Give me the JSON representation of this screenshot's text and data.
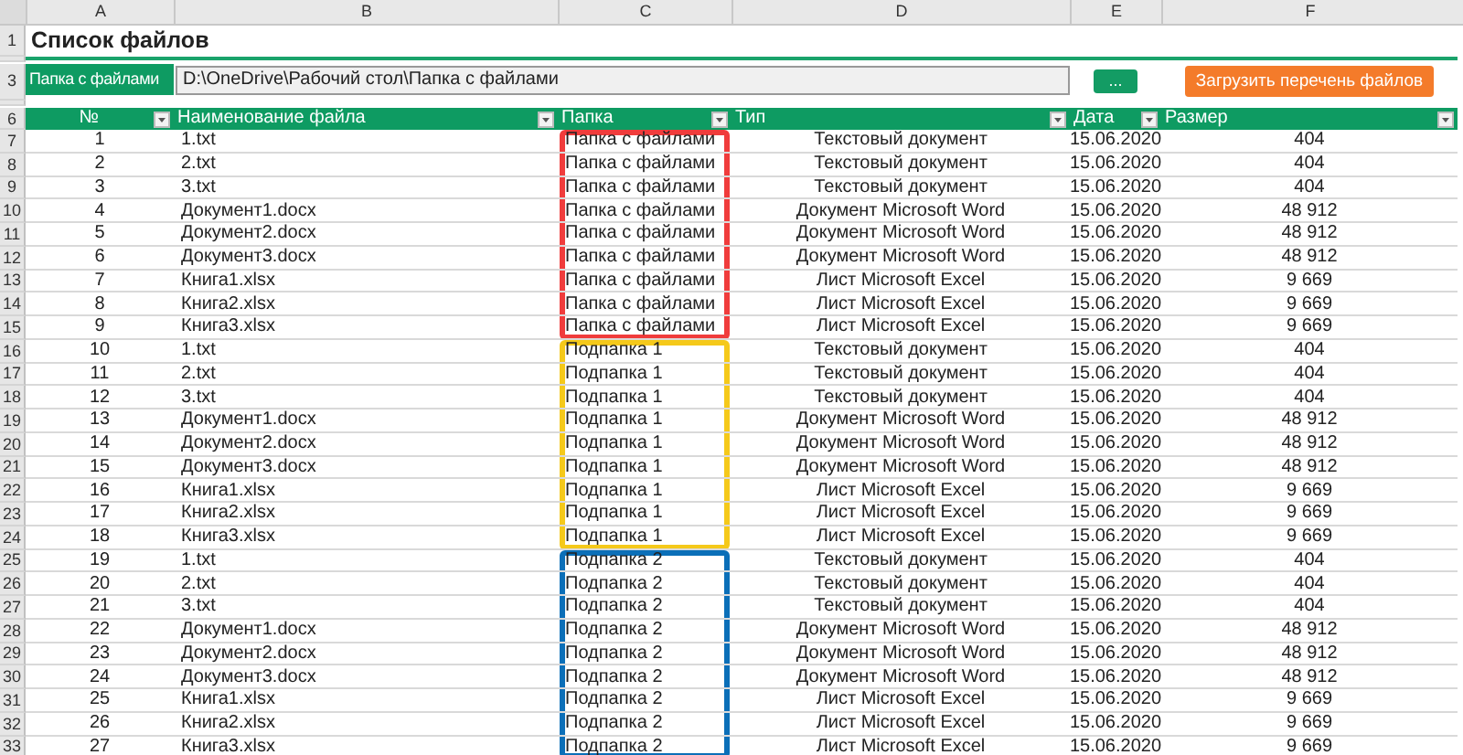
{
  "column_letters": [
    "A",
    "B",
    "C",
    "D",
    "E",
    "F"
  ],
  "title_row": {
    "row_number": "1",
    "title": "Список файлов"
  },
  "path_row": {
    "row_number": "3",
    "label": "Папка с файлами",
    "value": "D:\\OneDrive\\Рабочий стол\\Папка с файлами",
    "browse_button": "...",
    "load_button": "Загрузить перечень файлов"
  },
  "header_row": {
    "row_number": "6",
    "columns": [
      "№",
      "Наименование файла",
      "Папка",
      "Тип",
      "Дата",
      "Размер"
    ]
  },
  "groups": [
    {
      "color": "#f03c3c",
      "rows": [
        {
          "row_number": "7",
          "num": "1",
          "name": "1.txt",
          "folder": "Папка с файлами",
          "type": "Текстовый документ",
          "date": "15.06.2020",
          "size": "404"
        },
        {
          "row_number": "8",
          "num": "2",
          "name": "2.txt",
          "folder": "Папка с файлами",
          "type": "Текстовый документ",
          "date": "15.06.2020",
          "size": "404"
        },
        {
          "row_number": "9",
          "num": "3",
          "name": "3.txt",
          "folder": "Папка с файлами",
          "type": "Текстовый документ",
          "date": "15.06.2020",
          "size": "404"
        },
        {
          "row_number": "10",
          "num": "4",
          "name": "Документ1.docx",
          "folder": "Папка с файлами",
          "type": "Документ Microsoft Word",
          "date": "15.06.2020",
          "size": "48 912"
        },
        {
          "row_number": "11",
          "num": "5",
          "name": "Документ2.docx",
          "folder": "Папка с файлами",
          "type": "Документ Microsoft Word",
          "date": "15.06.2020",
          "size": "48 912"
        },
        {
          "row_number": "12",
          "num": "6",
          "name": "Документ3.docx",
          "folder": "Папка с файлами",
          "type": "Документ Microsoft Word",
          "date": "15.06.2020",
          "size": "48 912"
        },
        {
          "row_number": "13",
          "num": "7",
          "name": "Книга1.xlsx",
          "folder": "Папка с файлами",
          "type": "Лист Microsoft Excel",
          "date": "15.06.2020",
          "size": "9 669"
        },
        {
          "row_number": "14",
          "num": "8",
          "name": "Книга2.xlsx",
          "folder": "Папка с файлами",
          "type": "Лист Microsoft Excel",
          "date": "15.06.2020",
          "size": "9 669"
        },
        {
          "row_number": "15",
          "num": "9",
          "name": "Книга3.xlsx",
          "folder": "Папка с файлами",
          "type": "Лист Microsoft Excel",
          "date": "15.06.2020",
          "size": "9 669"
        }
      ]
    },
    {
      "color": "#f5c91a",
      "rows": [
        {
          "row_number": "16",
          "num": "10",
          "name": "1.txt",
          "folder": "Подпапка 1",
          "type": "Текстовый документ",
          "date": "15.06.2020",
          "size": "404"
        },
        {
          "row_number": "17",
          "num": "11",
          "name": "2.txt",
          "folder": "Подпапка 1",
          "type": "Текстовый документ",
          "date": "15.06.2020",
          "size": "404"
        },
        {
          "row_number": "18",
          "num": "12",
          "name": "3.txt",
          "folder": "Подпапка 1",
          "type": "Текстовый документ",
          "date": "15.06.2020",
          "size": "404"
        },
        {
          "row_number": "19",
          "num": "13",
          "name": "Документ1.docx",
          "folder": "Подпапка 1",
          "type": "Документ Microsoft Word",
          "date": "15.06.2020",
          "size": "48 912"
        },
        {
          "row_number": "20",
          "num": "14",
          "name": "Документ2.docx",
          "folder": "Подпапка 1",
          "type": "Документ Microsoft Word",
          "date": "15.06.2020",
          "size": "48 912"
        },
        {
          "row_number": "21",
          "num": "15",
          "name": "Документ3.docx",
          "folder": "Подпапка 1",
          "type": "Документ Microsoft Word",
          "date": "15.06.2020",
          "size": "48 912"
        },
        {
          "row_number": "22",
          "num": "16",
          "name": "Книга1.xlsx",
          "folder": "Подпапка 1",
          "type": "Лист Microsoft Excel",
          "date": "15.06.2020",
          "size": "9 669"
        },
        {
          "row_number": "23",
          "num": "17",
          "name": "Книга2.xlsx",
          "folder": "Подпапка 1",
          "type": "Лист Microsoft Excel",
          "date": "15.06.2020",
          "size": "9 669"
        },
        {
          "row_number": "24",
          "num": "18",
          "name": "Книга3.xlsx",
          "folder": "Подпапка 1",
          "type": "Лист Microsoft Excel",
          "date": "15.06.2020",
          "size": "9 669"
        }
      ]
    },
    {
      "color": "#0b6fb8",
      "rows": [
        {
          "row_number": "25",
          "num": "19",
          "name": "1.txt",
          "folder": "Подпапка 2",
          "type": "Текстовый документ",
          "date": "15.06.2020",
          "size": "404"
        },
        {
          "row_number": "26",
          "num": "20",
          "name": "2.txt",
          "folder": "Подпапка 2",
          "type": "Текстовый документ",
          "date": "15.06.2020",
          "size": "404"
        },
        {
          "row_number": "27",
          "num": "21",
          "name": "3.txt",
          "folder": "Подпапка 2",
          "type": "Текстовый документ",
          "date": "15.06.2020",
          "size": "404"
        },
        {
          "row_number": "28",
          "num": "22",
          "name": "Документ1.docx",
          "folder": "Подпапка 2",
          "type": "Документ Microsoft Word",
          "date": "15.06.2020",
          "size": "48 912"
        },
        {
          "row_number": "29",
          "num": "23",
          "name": "Документ2.docx",
          "folder": "Подпапка 2",
          "type": "Документ Microsoft Word",
          "date": "15.06.2020",
          "size": "48 912"
        },
        {
          "row_number": "30",
          "num": "24",
          "name": "Документ3.docx",
          "folder": "Подпапка 2",
          "type": "Документ Microsoft Word",
          "date": "15.06.2020",
          "size": "48 912"
        },
        {
          "row_number": "31",
          "num": "25",
          "name": "Книга1.xlsx",
          "folder": "Подпапка 2",
          "type": "Лист Microsoft Excel",
          "date": "15.06.2020",
          "size": "9 669"
        },
        {
          "row_number": "32",
          "num": "26",
          "name": "Книга2.xlsx",
          "folder": "Подпапка 2",
          "type": "Лист Microsoft Excel",
          "date": "15.06.2020",
          "size": "9 669"
        },
        {
          "row_number": "33",
          "num": "27",
          "name": "Книга3.xlsx",
          "folder": "Подпапка 2",
          "type": "Лист Microsoft Excel",
          "date": "15.06.2020",
          "size": "9 669"
        }
      ]
    }
  ]
}
